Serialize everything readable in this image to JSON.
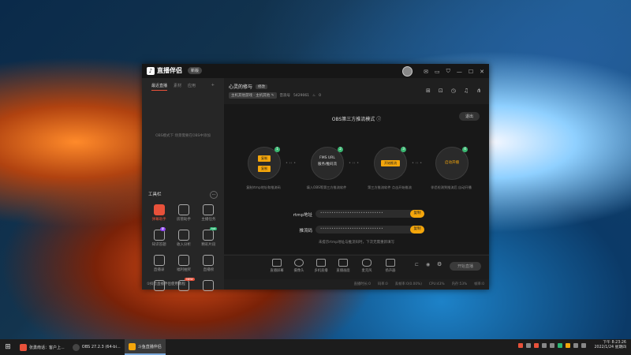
{
  "app": {
    "brand": "直播伴侣",
    "version_label": "新版",
    "title_icons": [
      "avatar",
      "mail-icon",
      "tv-icon",
      "shirt-icon",
      "minimize-icon",
      "maximize-icon",
      "close-icon"
    ]
  },
  "sidebar": {
    "tabs": [
      {
        "label": "最近直播",
        "active": true
      },
      {
        "label": "素材",
        "active": false
      },
      {
        "label": "应用",
        "active": false
      }
    ],
    "add_label": "+",
    "empty_text": "OBS模式下 场景需要在OBS中添加",
    "tools_title": "工具栏",
    "tools_more": "⋯",
    "tools": [
      {
        "label": "弹幕助手",
        "active": true,
        "badge": "",
        "badge_color": ""
      },
      {
        "label": "房管助手",
        "active": false,
        "badge": "",
        "badge_color": ""
      },
      {
        "label": "主播任务",
        "active": false,
        "badge": "",
        "badge_color": ""
      },
      {
        "label": "知识答题",
        "active": false,
        "badge": "新",
        "badge_color": "#8a3cf0"
      },
      {
        "label": "收入分析",
        "active": false,
        "badge": "",
        "badge_color": ""
      },
      {
        "label": "精彩片段",
        "active": false,
        "badge": "hot",
        "badge_color": "#2bb673"
      },
      {
        "label": "直播录",
        "active": false,
        "badge": "",
        "badge_color": ""
      },
      {
        "label": "福利抽奖",
        "active": false,
        "badge": "",
        "badge_color": ""
      },
      {
        "label": "直播榜",
        "active": false,
        "badge": "",
        "badge_color": ""
      },
      {
        "label": "",
        "active": false,
        "badge": "",
        "badge_color": ""
      },
      {
        "label": "",
        "active": false,
        "badge": "NEW",
        "badge_color": "#e8513a"
      },
      {
        "label": "",
        "active": false,
        "badge": "",
        "badge_color": ""
      }
    ],
    "bottom_text": "①抖音直播伴侣使用教程"
  },
  "room": {
    "title": "心灵的修与",
    "edit_tag": "修改",
    "category": "主机其他游戏 · 主机其他",
    "viewer_label": "音浪号",
    "viewer_value": "5429061",
    "likes": "0"
  },
  "header_icons": [
    "gift-icon",
    "lock-icon",
    "clock-icon",
    "bell-icon",
    "share-icon"
  ],
  "obs_mode": {
    "title": "OBS第三方推流模式",
    "exit_label": "退出",
    "steps": [
      {
        "num": "1",
        "pills": [
          "复制",
          "复制"
        ],
        "label": "",
        "desc": "复制rtmp地址和推流码"
      },
      {
        "num": "2",
        "pills": [],
        "label": "FMS URL\n服务/推码流",
        "desc": "填入OBS等第三方推流软件"
      },
      {
        "num": "3",
        "pills": [
          "开始推流"
        ],
        "label": "",
        "desc": "第三方推流软件 点击开始推流"
      },
      {
        "num": "4",
        "pills": [],
        "label": "启动开播",
        "desc": "伴侣检测到推流后 自动开播"
      }
    ],
    "rtmp_label": "rtmp地址",
    "rtmp_value": "••••••••••••••••••••••••••••",
    "key_label": "推流码",
    "key_value": "••••••••••••••••••••••••••••",
    "copy_label": "复制",
    "hint": "未提示rtmp地址与推流码时，下次无需重新填写"
  },
  "toolbar": {
    "buttons": [
      "直播屏幕",
      "摄像头",
      "多机直播",
      "直播画面",
      "麦克风",
      "扬声器"
    ],
    "start_label": "开始直播"
  },
  "status_bar": [
    "直播时长:0",
    "码率:0",
    "丢帧率:0(0.00%)",
    "CPU:43%",
    "内存:53%",
    "帧率:0"
  ],
  "taskbar": {
    "start_icon": "⊞",
    "items": [
      {
        "label": "张勇南话：客户上...",
        "color": "#e8513a",
        "active": false
      },
      {
        "label": "OBS 27.2.3 (64-bi...",
        "color": "#444444",
        "active": false
      },
      {
        "label": "斗鱼直播伴侣",
        "color": "#f4a60b",
        "active": true
      }
    ],
    "time": "下午 8:23:26",
    "date": "2022/1/24 星期四"
  }
}
